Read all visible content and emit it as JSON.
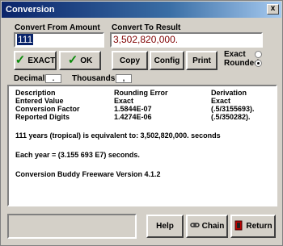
{
  "window": {
    "title": "Conversion",
    "close_glyph": "x"
  },
  "amount": {
    "label": "Convert From Amount",
    "value": "111"
  },
  "result": {
    "label": "Convert To Result",
    "value": "3,502,820,000."
  },
  "buttons": {
    "exact": "EXACT",
    "ok": "OK",
    "copy": "Copy",
    "config": "Config",
    "print": "Print",
    "help": "Help",
    "chain": "Chain",
    "return": "Return"
  },
  "mode": {
    "exact_label": "Exact",
    "rounded_label": "Rounded",
    "selected": "rounded"
  },
  "format": {
    "decimal_label": "Decimal:",
    "decimal_value": ".",
    "thousands_label": "Thousands:",
    "thousands_value": ","
  },
  "details": {
    "headers": [
      "Description",
      "Rounding Error",
      "Derivation"
    ],
    "rows": [
      [
        "Entered Value",
        "Exact",
        "Exact"
      ],
      [
        "Conversion Factor",
        "1.5844E-07",
        "(.5/3155693)."
      ],
      [
        "Reported Digits",
        "1.4274E-06",
        "(.5/350282)."
      ]
    ],
    "line1": "111 years (tropical) is equivalent to: 3,502,820,000. seconds",
    "line2": "Each year = (3.155 693 E7) seconds.",
    "line3": "Conversion Buddy Freeware Version 4.1.2"
  },
  "accent": {
    "check_green": "#0a8a0a",
    "selection": "#0a246a",
    "return_red": "#c00000"
  }
}
